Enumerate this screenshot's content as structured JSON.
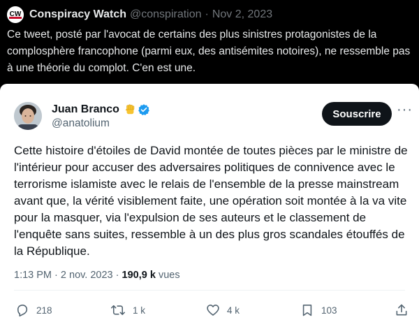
{
  "outer_tweet": {
    "logo_text": "CW",
    "author_name": "Conspiracy Watch",
    "handle": "@conspiration",
    "separator": "·",
    "date": "Nov 2, 2023",
    "text": "Ce tweet, posté par l'avocat de certains des plus sinistres protagonistes de la complosphère francophone (parmi eux, des antisémites notoires), ne ressemble pas à une théorie du complot. C'en est une."
  },
  "quoted_tweet": {
    "author_name": "Juan Branco",
    "handle": "@anatolium",
    "emoji_icon": "raised-fist-emoji",
    "verified_icon": "verified-badge-icon",
    "subscribe_label": "Souscrire",
    "more_label": "···",
    "text": "Cette histoire d'étoiles de David montée de toutes pièces par le ministre de l'intérieur pour accuser des adversaires politiques de connivence avec le terrorisme islamiste avec le relais de l'ensemble de la presse mainstream avant que, la vérité visiblement faite, une opération soit montée à la va vite pour la masquer, via l'expulsion de ses auteurs et le classement de l'enquête sans suites, ressemble à un des plus gros scandales étouffés de la République.",
    "time": "1:13 PM",
    "separator": "·",
    "date": "2 nov. 2023",
    "views_count": "190,9 k",
    "views_label": "vues",
    "actions": {
      "replies": "218",
      "reposts": "1 k",
      "likes": "4 k",
      "bookmarks": "103"
    }
  },
  "colors": {
    "accent": "#1d9bf0",
    "dark_bg": "#000000",
    "text_dark": "#0f1419",
    "muted": "#536471"
  }
}
